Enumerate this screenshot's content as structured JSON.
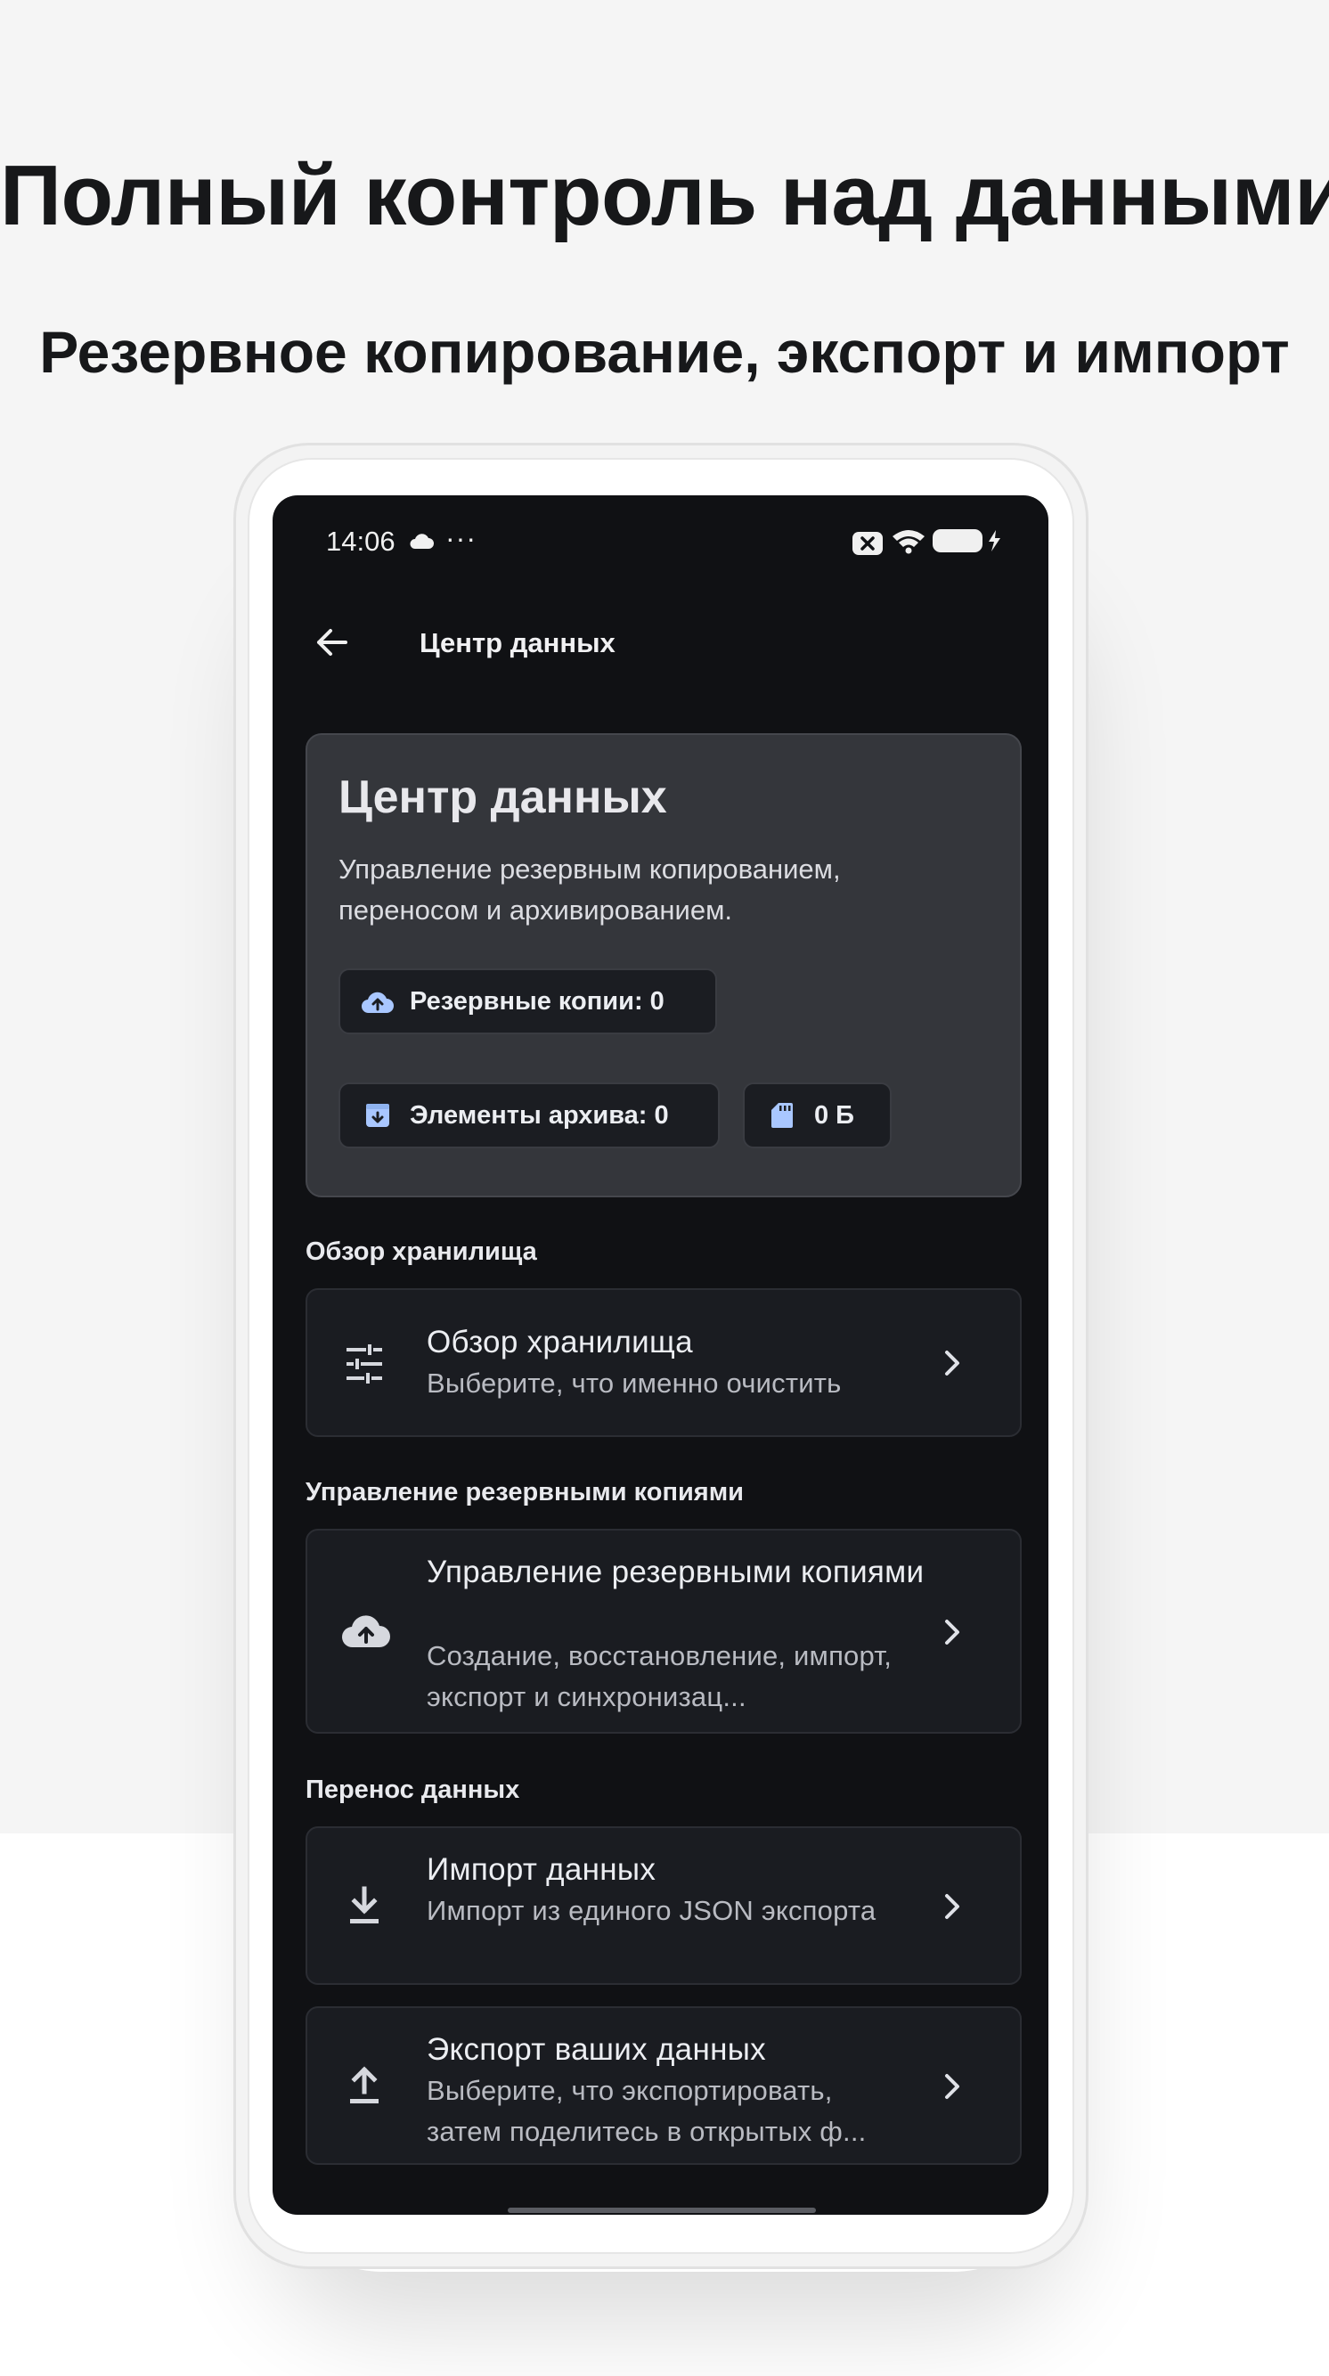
{
  "promo": {
    "headline": "Полный контроль над данными",
    "subheadline": "Резервное копирование, экспорт и импорт"
  },
  "status_bar": {
    "time": "14:06",
    "dots": "···",
    "icons": [
      "cloud-icon",
      "notification-x-icon",
      "wifi-icon",
      "battery-charging-icon"
    ]
  },
  "app_bar": {
    "title": "Центр данных",
    "back_icon": "arrow-left-icon"
  },
  "hero": {
    "title": "Центр данных",
    "description": "Управление резервным копированием, переносом и архивированием.",
    "chips": [
      {
        "icon": "cloud-upload-icon",
        "label": "Резервные копии: 0"
      },
      {
        "icon": "archive-icon",
        "label": "Элементы архива: 0"
      },
      {
        "icon": "sd-card-icon",
        "label": "0 Б"
      }
    ]
  },
  "sections": [
    {
      "label": "Обзор хранилища",
      "items": [
        {
          "icon": "tune-icon",
          "title": "Обзор хранилища",
          "subtitle": "Выберите, что именно очистить"
        }
      ]
    },
    {
      "label": "Управление резервными копиями",
      "items": [
        {
          "icon": "cloud-upload-icon",
          "title": "Управление резервными копиями",
          "subtitle": "Создание, восстановление, импорт, экспорт и синхронизац..."
        }
      ]
    },
    {
      "label": "Перенос данных",
      "items": [
        {
          "icon": "download-icon",
          "title": "Импорт данных",
          "subtitle": "Импорт из единого JSON экспорта"
        },
        {
          "icon": "upload-icon",
          "title": "Экспорт ваших данных",
          "subtitle": "Выберите, что экспортировать, затем поделитесь в открытых ф..."
        }
      ]
    }
  ],
  "colors": {
    "screen_bg": "#101114",
    "hero_bg": "#34363b",
    "card_bg": "#1a1c21",
    "chip_icon_accent": "#a9c7ff",
    "text_primary": "#eceef2",
    "text_secondary": "#b9bbc2"
  }
}
